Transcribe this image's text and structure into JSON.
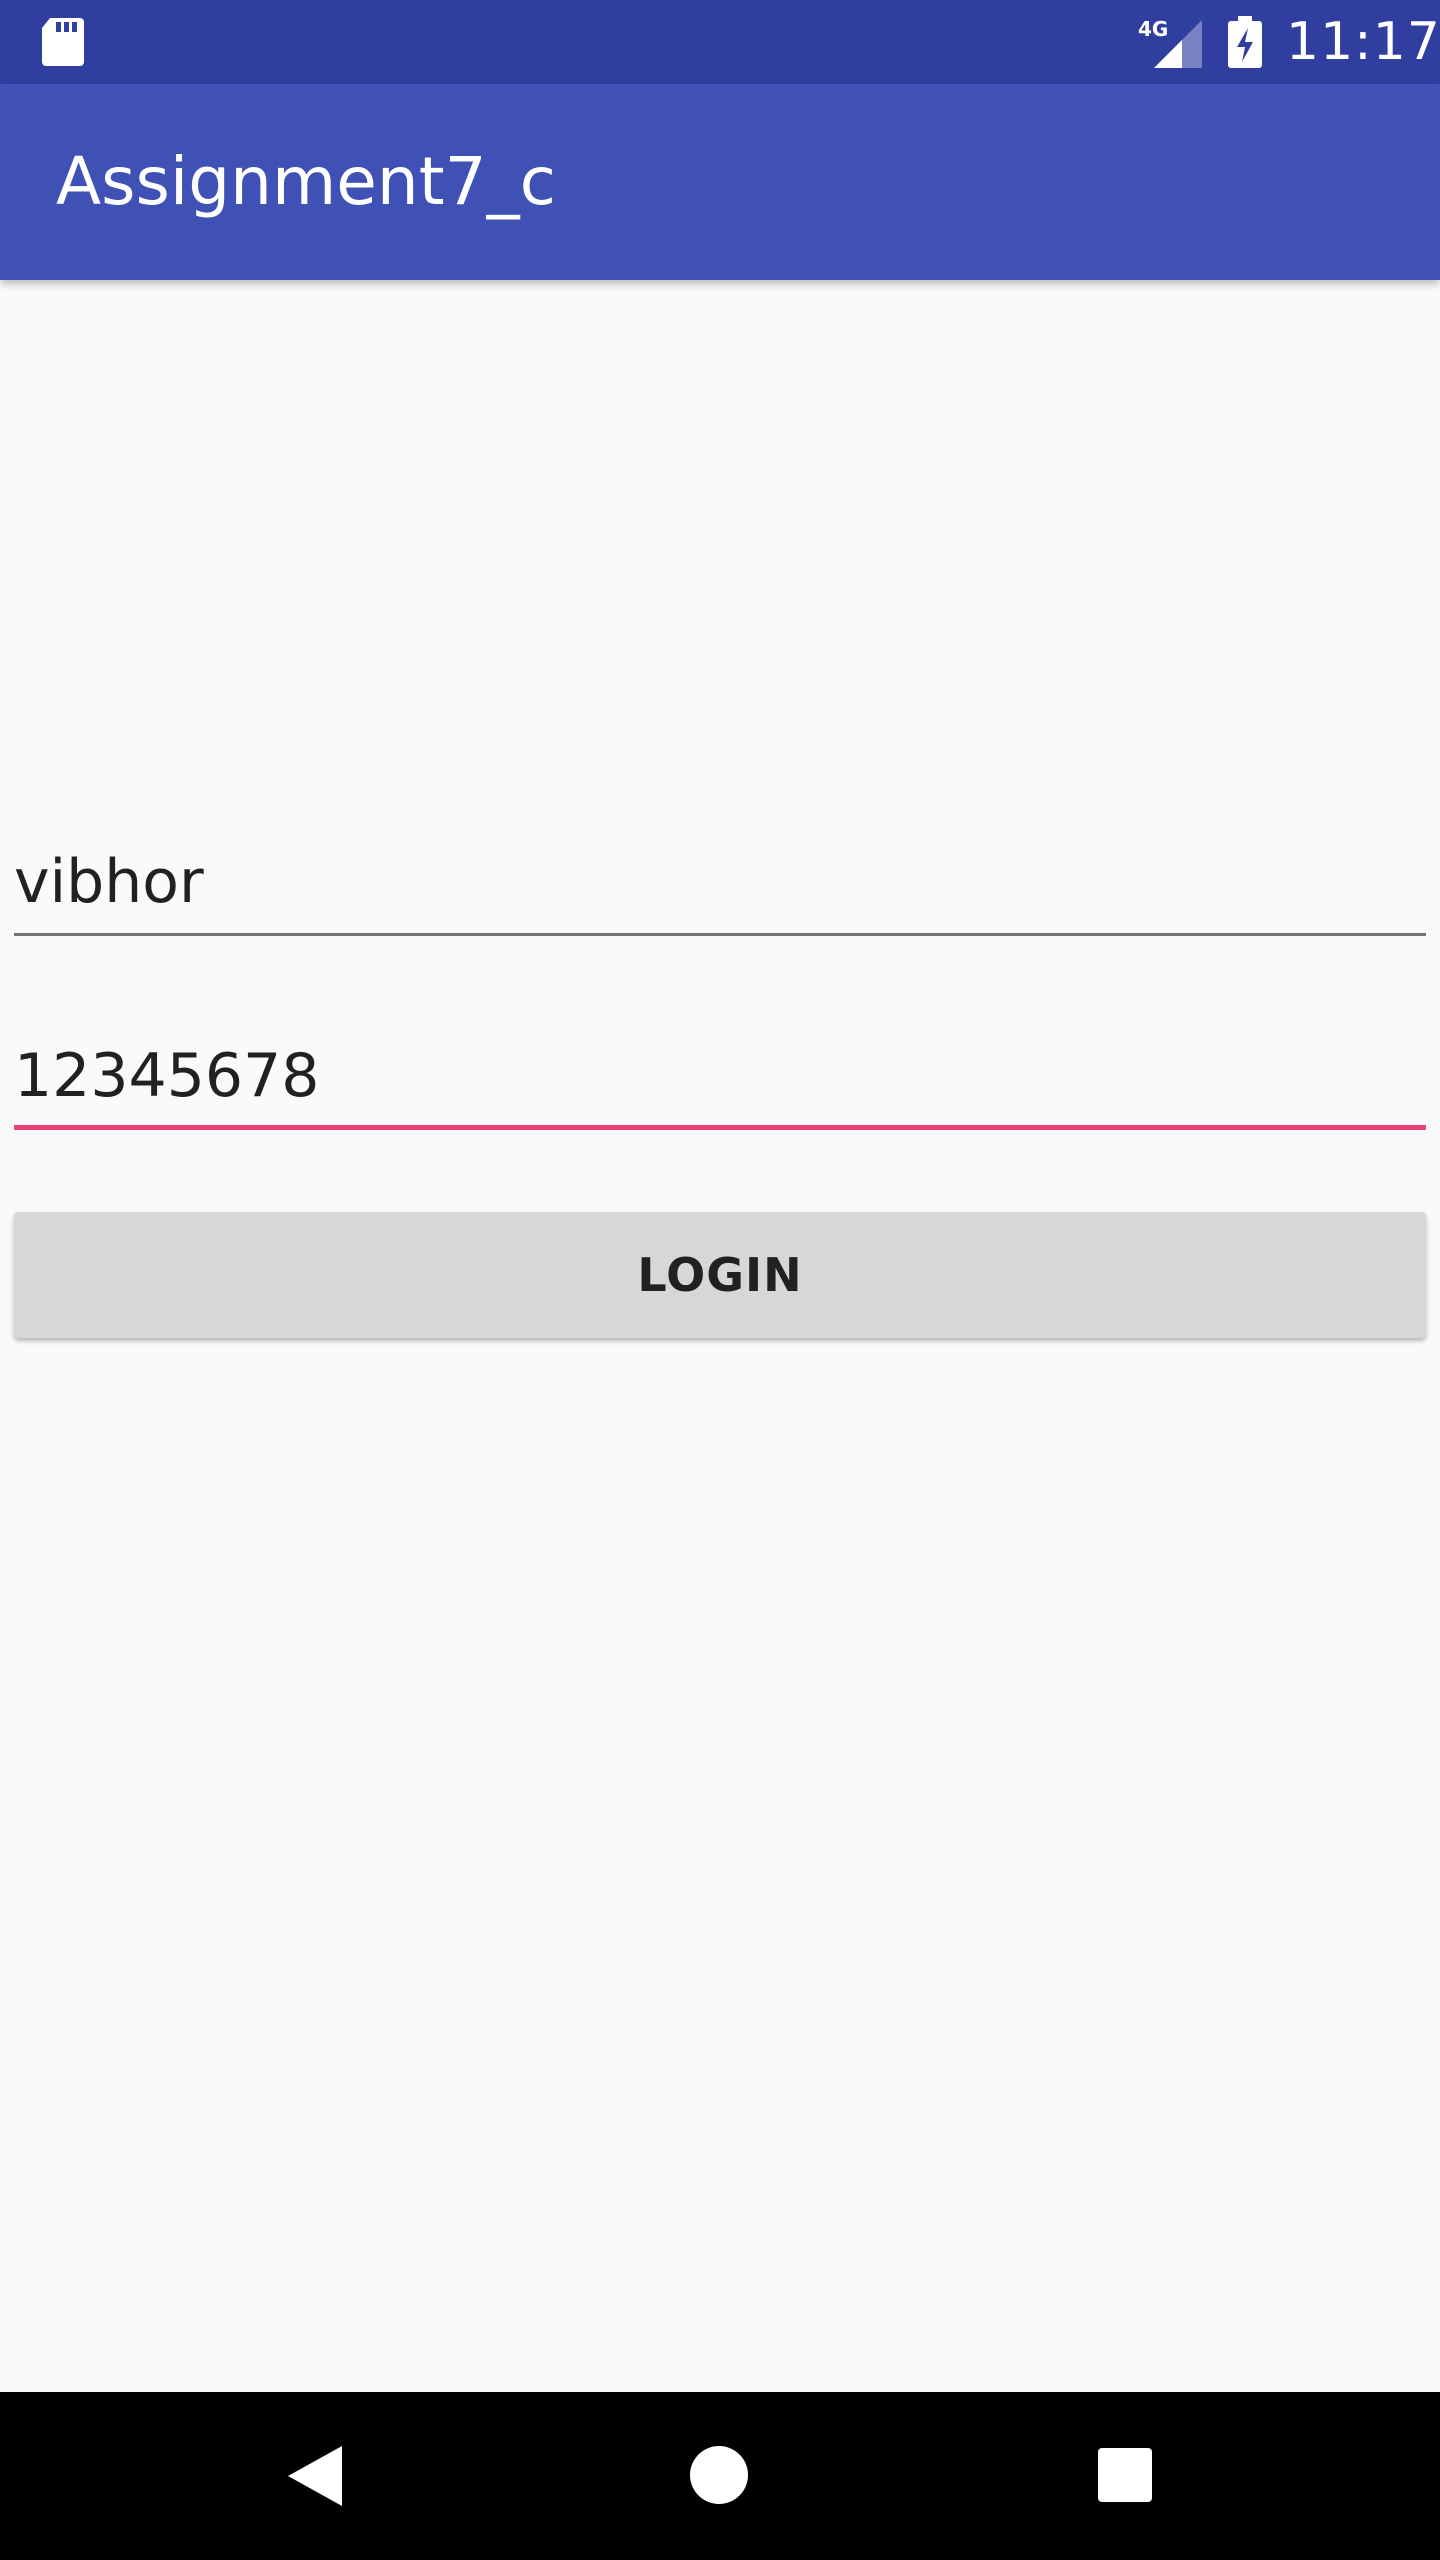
{
  "status_bar": {
    "time": "11:17",
    "network_label": "4G",
    "icons": [
      "sd-card-icon",
      "signal-4g-icon",
      "battery-charging-icon"
    ]
  },
  "app_bar": {
    "title": "Assignment7_c"
  },
  "form": {
    "username_value": "vibhor",
    "password_value": "12345678",
    "login_label": "LOGIN"
  },
  "nav_bar": {
    "icons": [
      "back-icon",
      "home-icon",
      "recents-icon"
    ]
  },
  "colors": {
    "status_bar": "#303f9f",
    "app_bar": "#3f51b5",
    "accent": "#ec407a",
    "background": "#fafafa",
    "button": "#d6d7d7"
  }
}
